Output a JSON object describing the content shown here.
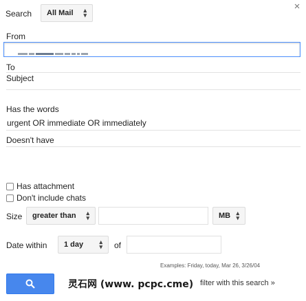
{
  "close_glyph": "×",
  "search": {
    "label": "Search",
    "scope_value": "All Mail"
  },
  "fields": {
    "from_label": "From",
    "to_label": "To",
    "subject_label": "Subject",
    "has_words_label": "Has the words",
    "has_words_value": "urgent OR immediate OR immediately",
    "doesnt_have_label": "Doesn't have"
  },
  "checkboxes": {
    "has_attachment": "Has attachment",
    "dont_include_chats": "Don't include chats"
  },
  "size": {
    "label": "Size",
    "operator": "greater than",
    "unit": "MB"
  },
  "date": {
    "label": "Date within",
    "range": "1 day",
    "of_label": "of"
  },
  "examples": "Examples: Friday, today, Mar 26, 3/26/04",
  "footer": {
    "watermark": "灵石网 (www. pcpc.cme)",
    "filter_link": "filter with this search »"
  },
  "colors": {
    "accent_blue": "#4787ed",
    "focus_border": "#4d90fe"
  }
}
